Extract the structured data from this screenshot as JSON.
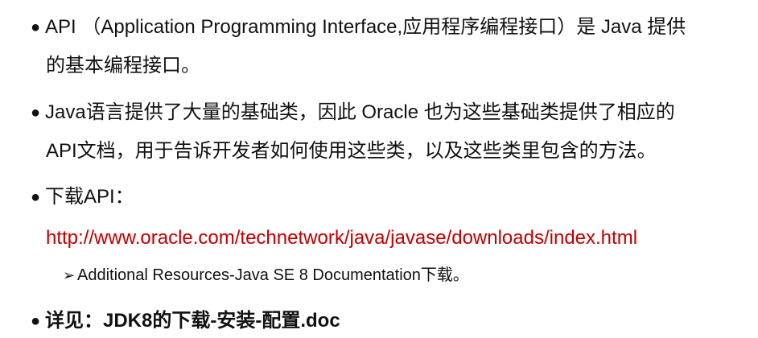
{
  "bullets": [
    {
      "line1": "API （Application Programming Interface,应用程序编程接口）是 Java 提供",
      "line2": "的基本编程接口。"
    },
    {
      "line1": "Java语言提供了大量的基础类，因此 Oracle 也为这些基础类提供了相应的",
      "line2": "API文档，用于告诉开发者如何使用这些类，以及这些类里包含的方法。"
    },
    {
      "line1": "下载API：",
      "link": "http://www.oracle.com/technetwork/java/javase/downloads/index.html",
      "sub": "Additional Resources-Java SE 8 Documentation下载。"
    },
    {
      "line1": "详见：JDK8的下载-安装-配置.doc"
    }
  ],
  "glyphs": {
    "bullet": "●",
    "sub_arrow": "➢"
  },
  "colors": {
    "link": "#c00000",
    "text": "#111111"
  }
}
